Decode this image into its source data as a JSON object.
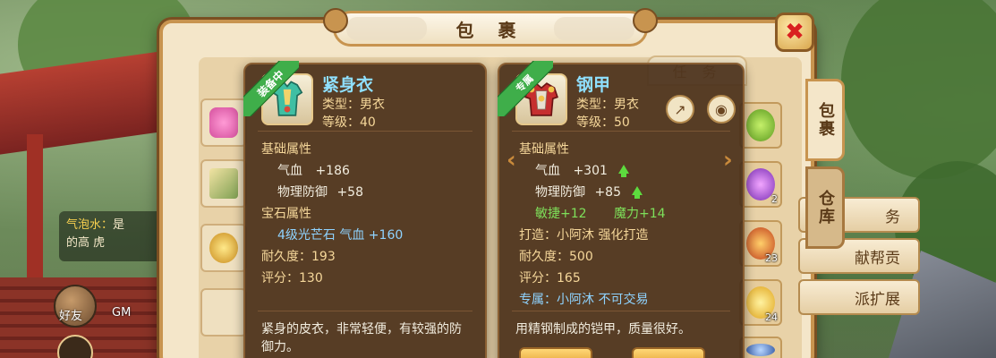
{
  "window": {
    "title": "包 裹",
    "close_label": "✖"
  },
  "tabs": {
    "top_tab": "任 务",
    "side_bag": "包裹",
    "side_store": "仓库"
  },
  "guild_menu": [
    "务",
    "献帮贡",
    "派扩展"
  ],
  "chat": {
    "line1_name": "气泡水：",
    "line1_suffix": "是",
    "line2": "的高 ",
    "line2_suffix": "虎"
  },
  "hud": {
    "friend_label": "好友",
    "gm_label": "GM"
  },
  "item_counts": [
    "2",
    "23",
    "24"
  ],
  "cards": {
    "left": {
      "ribbon": "装备中",
      "name": "紧身衣",
      "type_label": "类型：男衣",
      "level_label": "等级：40",
      "section_base": "基础属性",
      "base_stats": [
        {
          "label": "气血",
          "value": "+186"
        },
        {
          "label": "物理防御",
          "value": "+58"
        }
      ],
      "section_gem": "宝石属性",
      "gem_line": "4级光芒石  气血  +160",
      "durability": "耐久度：193",
      "score": "评分：130",
      "description": "紧身的皮衣，非常轻便，有较强的防御力。"
    },
    "right": {
      "ribbon": "专属",
      "name": "钢甲",
      "type_label": "类型：男衣",
      "level_label": "等级：50",
      "section_base": "基础属性",
      "base_stats": [
        {
          "label": "气血",
          "value": "+301"
        },
        {
          "label": "物理防御",
          "value": "+85"
        }
      ],
      "bonus_left": "敏捷+12",
      "bonus_right": "魔力+14",
      "forge": "打造：小阿沐   强化打造",
      "durability": "耐久度：500",
      "score": "评分：165",
      "exclusive": "专属：小阿沐  不可交易",
      "description": "用精钢制成的铠甲，质量很好。"
    }
  },
  "colors": {
    "panel_bg": "#f4e6c9",
    "panel_border": "#c8944f",
    "card_bg": "#4a301a",
    "name_blue": "#8fe0ff",
    "stat_yellow": "#f5d79a",
    "stat_green": "#7ee05a",
    "gem_blue": "#8fd3ff",
    "ribbon_green": "#3fae4a"
  }
}
